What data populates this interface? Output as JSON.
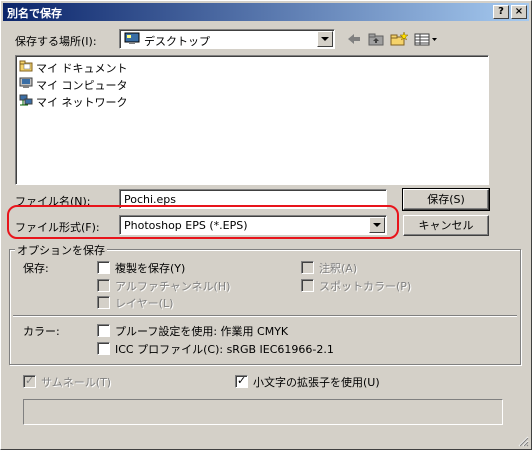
{
  "window": {
    "title": "別名で保存",
    "help_button": "?",
    "close_button": "×"
  },
  "location": {
    "label": "保存する場所(I):",
    "value": "デスクトップ"
  },
  "toolbar_icons": [
    "back-arrow-icon",
    "up-folder-icon",
    "new-folder-icon",
    "view-menu-icon"
  ],
  "file_list": [
    {
      "label": "マイ ドキュメント",
      "icon": "my-documents-icon"
    },
    {
      "label": "マイ コンピュータ",
      "icon": "my-computer-icon"
    },
    {
      "label": "マイ ネットワーク",
      "icon": "my-network-icon"
    }
  ],
  "filename": {
    "label": "ファイル名(N):",
    "value": "Pochi.eps"
  },
  "filetype": {
    "label": "ファイル形式(F):",
    "value": "Photoshop EPS (*.EPS)"
  },
  "buttons": {
    "save": "保存(S)",
    "cancel": "キャンセル"
  },
  "options": {
    "group_title": "オプションを保存",
    "save_label": "保存:",
    "copy": {
      "label": "複製を保存(Y)",
      "checked": false,
      "enabled": true
    },
    "notes": {
      "label": "注釈(A)",
      "checked": false,
      "enabled": false
    },
    "alpha": {
      "label": "アルファチャンネル(H)",
      "checked": false,
      "enabled": false
    },
    "spot": {
      "label": "スポットカラー(P)",
      "checked": false,
      "enabled": false
    },
    "layers": {
      "label": "レイヤー(L)",
      "checked": false,
      "enabled": false
    },
    "color_label": "カラー:",
    "proof": {
      "label": "プルーフ設定を使用: 作業用 CMYK",
      "checked": false,
      "enabled": true
    },
    "icc": {
      "label": "ICC プロファイル(C): sRGB IEC61966-2.1",
      "checked": false,
      "enabled": true
    }
  },
  "thumbnail": {
    "label": "サムネール(T)",
    "checked": true,
    "enabled": false
  },
  "lowercase_ext": {
    "label": "小文字の拡張子を使用(U)",
    "checked": true,
    "enabled": true
  },
  "accent_color": "#e8141b"
}
